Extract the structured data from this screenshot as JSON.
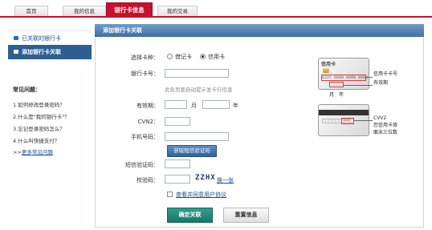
{
  "tabs": [
    {
      "label": "首页",
      "active": false
    },
    {
      "label": "我的信息",
      "active": false
    },
    {
      "label": "银行卡信息",
      "active": true
    },
    {
      "label": "我的交易",
      "active": false
    }
  ],
  "sidebar": {
    "items": [
      {
        "label": "已关联的银行卡",
        "icon": "card-icon"
      },
      {
        "label": "添加银行卡关联",
        "icon": "card-icon"
      }
    ],
    "faq_title": "常见问题：",
    "faq": [
      "1.如何修改登录密码？",
      "2.什么是\"我的银行卡\"？",
      "3.忘记登录密码怎么？",
      "4.什么叫快捷支付？"
    ],
    "more_prefix": ">>",
    "more_link": "更多常见问题"
  },
  "main": {
    "title": "添加银行卡关联",
    "form": {
      "card_type_label": "选择卡种：",
      "card_type_options": [
        {
          "label": "借记卡",
          "selected": false
        },
        {
          "label": "信用卡",
          "selected": true
        }
      ],
      "card_number_label": "银行卡号：",
      "card_number_value": "",
      "card_number_hint": "此处页面自动提示发卡行信息",
      "expiry_label": "有效期：",
      "month_unit": "月",
      "year_unit": "年",
      "cvn2_label": "CVN2：",
      "phone_label": "手机号码：",
      "sms_button": "获取短信验证码",
      "sms_code_label": "短信验证码：",
      "captcha_label": "校验码：",
      "captcha_text": "ZZHX",
      "captcha_refresh": "换一张",
      "agreement": "查看并同意用户协议",
      "confirm_button": "确定关联",
      "reset_button": "重置信息"
    },
    "illustration": {
      "card_front_title": "信用卡",
      "ann_number": "信用卡卡号",
      "ann_expiry": "有效期",
      "month": "月",
      "year": "年",
      "ann_cvv_1": "CVV2",
      "ann_cvv_2": "您信用卡背",
      "ann_cvv_3": "面末三位数",
      "card_num_sample": "6225 8888 8888 8888",
      "cvv_sample": "123"
    }
  },
  "colors": {
    "brand_red": "#c8102e",
    "nav_blue": "#2d5e94",
    "confirm_green": "#17786a"
  }
}
